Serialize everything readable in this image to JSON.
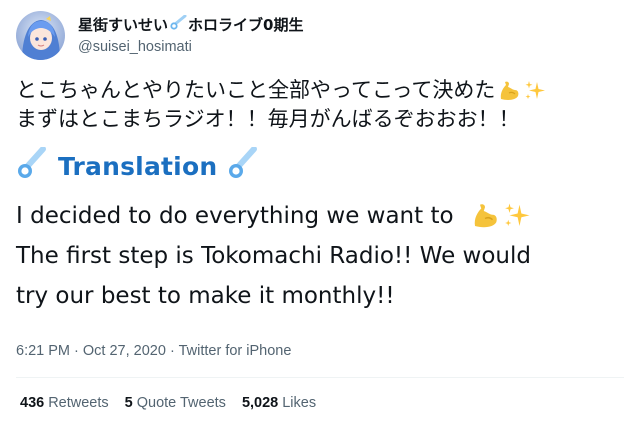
{
  "author": {
    "display_name": "星街すいせい",
    "display_name_suffix": "ホロライブ0期生",
    "handle": "@suisei_hosimati",
    "avatar_icon": "avatar-image"
  },
  "tweet": {
    "jp_line1": "とこちゃんとやりたいこと全部やってこって決めた",
    "jp_line2": "まずはとこまちラジオ！！毎月がんばるぞおおお！！",
    "translation_label": "Translation",
    "en_line1": "I decided to do everything we want to",
    "en_line2": "The first step is Tokomachi Radio!! We would",
    "en_line3": "try our best to make it monthly!!",
    "emoji": [
      "flexed-biceps-icon",
      "sparkles-icon",
      "comet-icon"
    ]
  },
  "meta": {
    "time": "6:21 PM",
    "date": "Oct 27, 2020",
    "source": "Twitter for iPhone",
    "separator": "·"
  },
  "stats": {
    "retweets_count": "436",
    "retweets_label": "Retweets",
    "quotes_count": "5",
    "quotes_label": "Quote Tweets",
    "likes_count": "5,028",
    "likes_label": "Likes"
  },
  "colors": {
    "translation_blue": "#1b6fc0",
    "secondary_text": "#536471",
    "primary_text": "#0f1419"
  }
}
